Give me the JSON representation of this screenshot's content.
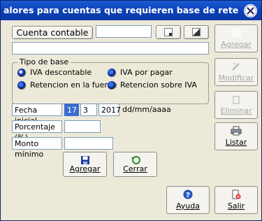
{
  "window": {
    "title": "alores para cuentas que requieren base de rete"
  },
  "form": {
    "cuenta_button": "Cuenta contable",
    "cuenta_value": "",
    "descripcion_value": "",
    "tipo_de_base_label": "Tipo de base",
    "radio_iva_descontable": "IVA descontable",
    "radio_iva_por_pagar": "IVA por pagar",
    "radio_retencion_fuente": "Retencion en la fuente",
    "radio_retencion_iva": "Retencion sobre IVA",
    "fecha_label": "Fecha inicial",
    "fecha_dia": "17",
    "fecha_mes": "3",
    "fecha_anio": "2017",
    "fecha_formato": "dd/mm/aaaa",
    "porcentaje_label": "Porcentaje (%)",
    "porcentaje_value": "",
    "monto_label": "Monto mínimo",
    "monto_value": ""
  },
  "actions": {
    "agregar": "Agregar",
    "cerrar": "Cerrar",
    "side_agregar": "Agregar",
    "modificar": "Modificar",
    "eliminar": "Eliminar",
    "listar": "Listar",
    "ayuda": "Ayuda",
    "salir": "Salir"
  }
}
